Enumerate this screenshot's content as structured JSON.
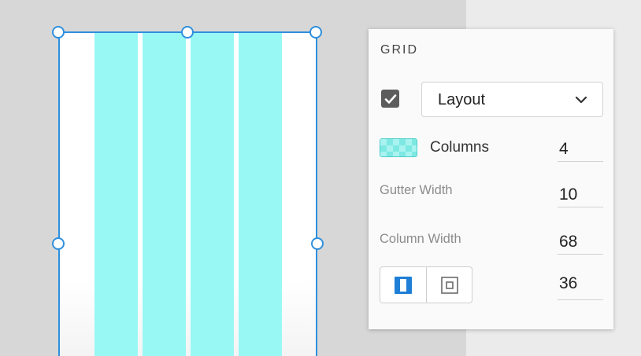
{
  "panel": {
    "title": "GRID",
    "grid_type": {
      "enabled": true,
      "selected": "Layout"
    },
    "columns": {
      "label": "Columns",
      "value": "4"
    },
    "gutter_width": {
      "label": "Gutter Width",
      "value": "10"
    },
    "column_width": {
      "label": "Column Width",
      "value": "68"
    },
    "margin": {
      "value": "36",
      "linked": true
    }
  },
  "colors": {
    "selection": "#2f8fdd",
    "grid_column": "#98f8f4",
    "swatch": "#7ee8e3"
  },
  "icons": {
    "checkbox": "checkmark-icon",
    "dropdown": "chevron-down-icon",
    "linked_margins": "linked-margins-icon",
    "individual_margins": "individual-margins-icon"
  }
}
